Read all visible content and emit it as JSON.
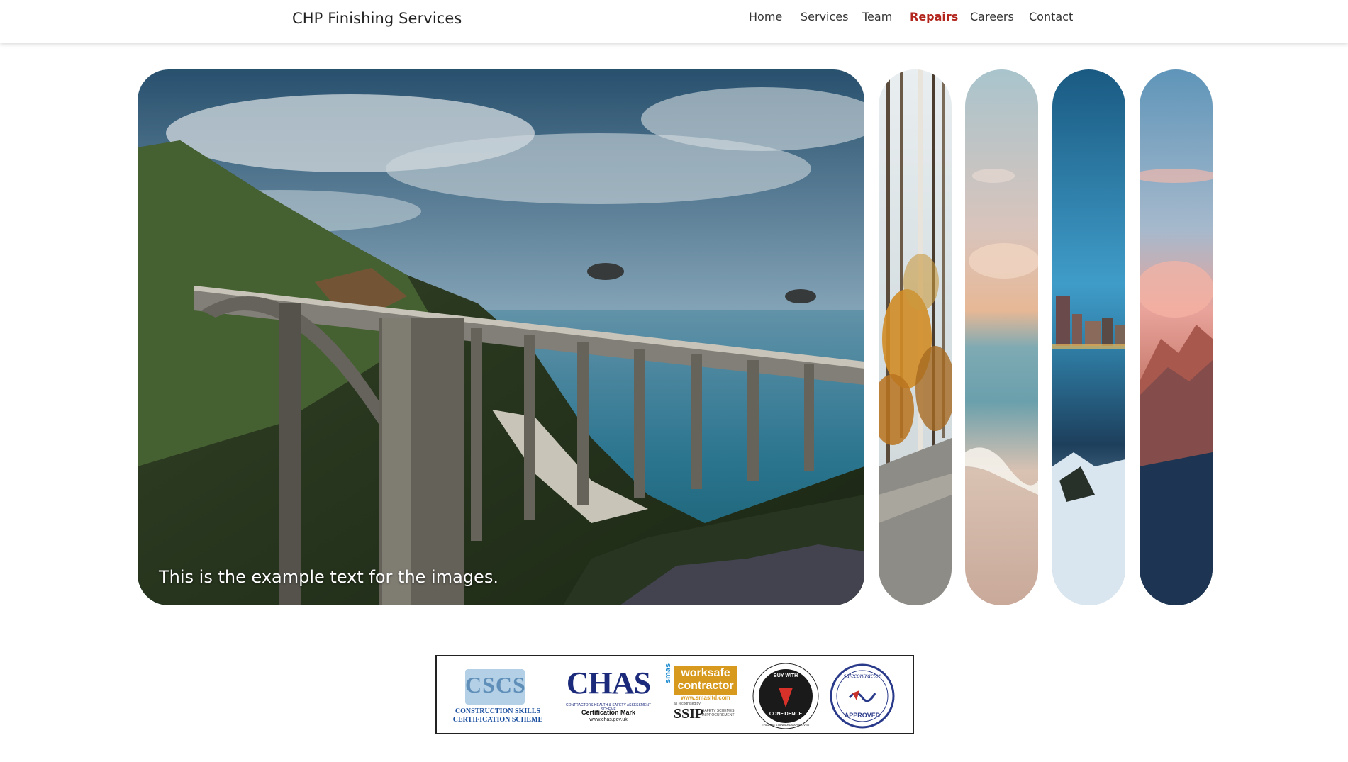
{
  "header": {
    "brand": "CHP Finishing Services",
    "nav": [
      {
        "label": "Home",
        "active": false
      },
      {
        "label": "Services",
        "active": false
      },
      {
        "label": "Team",
        "active": false
      },
      {
        "label": "Repairs",
        "active": true
      },
      {
        "label": "Careers",
        "active": false
      },
      {
        "label": "Contact",
        "active": false
      }
    ],
    "active_color": "#b3261e"
  },
  "gallery": {
    "caption": "This is the example text for the images.",
    "images": [
      {
        "name": "bridge-coast",
        "active": true
      },
      {
        "name": "autumn-forest-path",
        "active": false
      },
      {
        "name": "beach-sunset",
        "active": false
      },
      {
        "name": "city-waterfront-snow",
        "active": false
      },
      {
        "name": "mountain-sunset",
        "active": false
      }
    ]
  },
  "badges": {
    "cscs": {
      "logo": "CSCS",
      "line1": "CONSTRUCTION SKILLS",
      "line2": "CERTIFICATION SCHEME"
    },
    "chas": {
      "logo": "CHAS",
      "small": "CONTRACTORS HEALTH & SAFETY ASSESSMENT SCHEME",
      "mark": "Certification Mark",
      "url": "www.chas.gov.uk"
    },
    "smas": {
      "brand": "smas",
      "title1": "worksafe",
      "title2": "contractor",
      "url": "www.smasltd.com",
      "recognised": "as recognised by",
      "ssip": "SSIP",
      "ssip_text": "SAFETY SCHEMES IN PROCUREMENT"
    },
    "bwc": {
      "top": "BUY WITH",
      "bottom": "CONFIDENCE",
      "outer": "TRADING STANDARDS APPROVED"
    },
    "safecontractor": {
      "top": "safecontractor",
      "bottom": "APPROVED"
    }
  }
}
